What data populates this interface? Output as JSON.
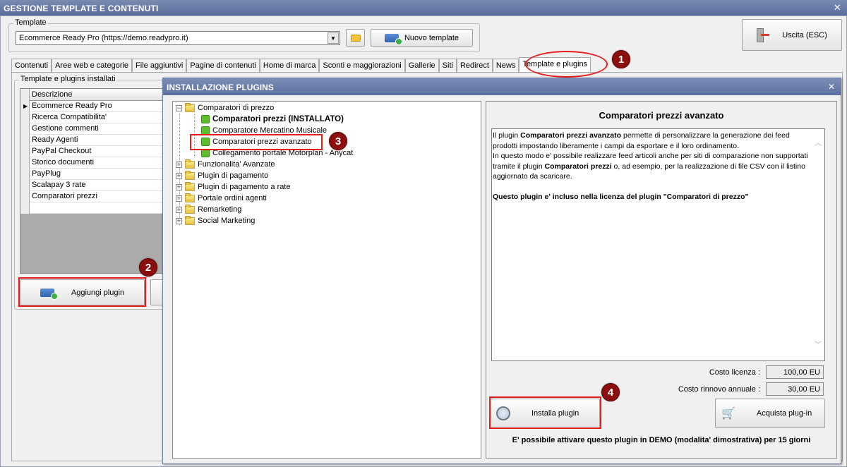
{
  "window": {
    "title": "GESTIONE TEMPLATE E CONTENUTI",
    "close_glyph": "✕"
  },
  "template": {
    "legend": "Template",
    "selected": "Ecommerce Ready Pro (https://demo.readypro.it)",
    "new_button": "Nuovo template"
  },
  "exit_button": "Uscita (ESC)",
  "tabs": [
    "Contenuti",
    "Aree web e categorie",
    "File aggiuntivi",
    "Pagine di contenuti",
    "Home di marca",
    "Sconti e maggiorazioni",
    "Gallerie",
    "Siti",
    "Redirect",
    "News",
    "Template e plugins"
  ],
  "installed": {
    "legend": "Template e plugins installati",
    "column": "Descrizione",
    "rows": [
      "Ecommerce Ready Pro",
      "Ricerca Compatibilita'",
      "Gestione commenti",
      "Ready Agenti",
      "PayPal Checkout",
      "Storico documenti",
      "PayPlug",
      "Scalapay 3 rate",
      "Comparatori prezzi"
    ],
    "add_button": "Aggiungi plugin"
  },
  "badges": [
    "1",
    "2",
    "3",
    "4"
  ],
  "dialog": {
    "title": "INSTALLAZIONE PLUGINS",
    "close_glyph": "✕",
    "tree": {
      "root_expanded": "Comparatori di prezzo",
      "children": [
        "Comparatori prezzi (INSTALLATO)",
        "Comparatore Mercatino Musicale",
        "Comparatori prezzi avanzato",
        "Collegamento portale Motorplan - Anycat"
      ],
      "collapsed": [
        "Funzionalita' Avanzate",
        "Plugin di pagamento",
        "Plugin di pagamento a rate",
        "Portale ordini agenti",
        "Remarketing",
        "Social Marketing"
      ]
    },
    "detail": {
      "title": "Comparatori prezzi avanzato",
      "desc_p1_a": "Il plugin ",
      "desc_p1_b": "Comparatori prezzi avanzato",
      "desc_p1_c": " permette di personalizzare la generazione dei feed prodotti impostando liberamente i campi da esportare e il loro ordinamento.",
      "desc_p2_a": "In questo modo e' possibile realizzare feed articoli anche per siti di comparazione non supportati tramite il plugin ",
      "desc_p2_b": "Comparatori prezzi",
      "desc_p2_c": " o, ad esempio, per la realizzazione di file CSV con il listino aggiornato da scaricare.",
      "desc_p3": "Questo plugin e' incluso nella licenza del plugin \"Comparatori di prezzo\"",
      "license_label": "Costo licenza :",
      "license_value": "100,00 EU",
      "renewal_label": "Costo rinnovo annuale :",
      "renewal_value": "30,00 EU",
      "install_button": "Installa plugin",
      "buy_button": "Acquista plug-in",
      "demo_note": "E' possibile attivare questo plugin in DEMO (modalita' dimostrativa) per 15 giorni"
    }
  }
}
